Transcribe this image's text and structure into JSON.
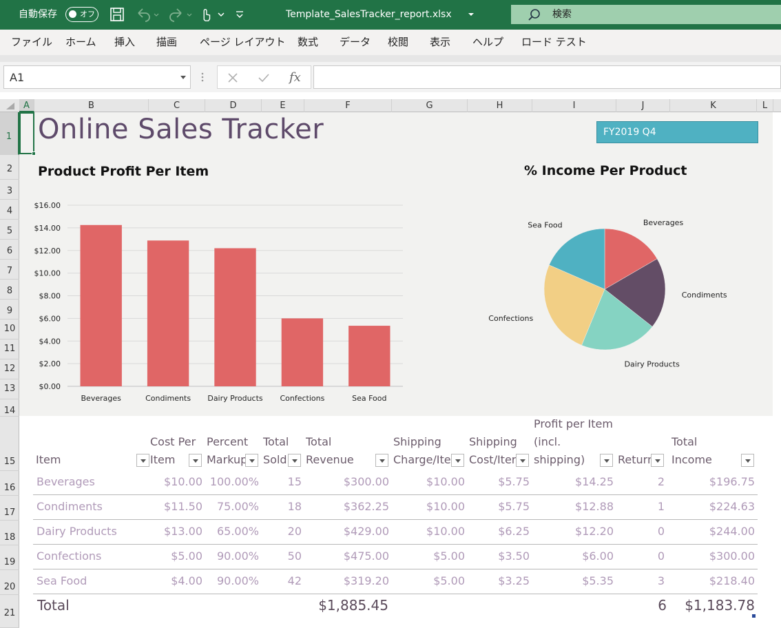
{
  "titlebar": {
    "autosave_label": "自動保存",
    "autosave_state": "オフ",
    "filename": "Template_SalesTracker_report.xlsx",
    "search_placeholder": "検索"
  },
  "menu": [
    "ファイル",
    "ホーム",
    "挿入",
    "描画",
    "ページ レイアウト",
    "数式",
    "データ",
    "校閲",
    "表示",
    "ヘルプ",
    "ロード テスト"
  ],
  "formula_bar": {
    "name_box": "A1",
    "fx": "fx",
    "formula": ""
  },
  "columns": [
    "A",
    "B",
    "C",
    "D",
    "E",
    "F",
    "G",
    "H",
    "I",
    "J",
    "K",
    "L"
  ],
  "rows": [
    "1",
    "2",
    "3",
    "4",
    "5",
    "6",
    "7",
    "8",
    "9",
    "10",
    "11",
    "12",
    "13",
    "14",
    "15",
    "16",
    "17",
    "18",
    "19",
    "20",
    "21"
  ],
  "sheet": {
    "title": "Online Sales Tracker",
    "period": "FY2019 Q4"
  },
  "chart_data": [
    {
      "type": "bar",
      "title": "Product Profit Per Item",
      "categories": [
        "Beverages",
        "Condiments",
        "Dairy Products",
        "Confections",
        "Sea Food"
      ],
      "values": [
        14.25,
        12.88,
        12.2,
        6.0,
        5.35
      ],
      "ylim": [
        0,
        16
      ],
      "yticks": [
        "$0.00",
        "$2.00",
        "$4.00",
        "$6.00",
        "$8.00",
        "$10.00",
        "$12.00",
        "$14.00",
        "$16.00"
      ],
      "grid": true,
      "color": "#e06666"
    },
    {
      "type": "pie",
      "title": "% Income Per Product",
      "categories": [
        "Beverages",
        "Condiments",
        "Dairy Products",
        "Confections",
        "Sea Food"
      ],
      "values": [
        196.75,
        224.63,
        244.0,
        300.0,
        218.4
      ],
      "colors": [
        "#e06666",
        "#634d66",
        "#85d3c2",
        "#f2cf85",
        "#4fb1c2"
      ]
    }
  ],
  "table": {
    "headers": [
      [
        "Item"
      ],
      [
        "Cost Per",
        "Item"
      ],
      [
        "Percent",
        "Markup"
      ],
      [
        "Total",
        "Sold"
      ],
      [
        "Total",
        "Revenue"
      ],
      [
        "Shipping",
        "Charge/Ite"
      ],
      [
        "Shipping",
        "Cost/Iter"
      ],
      [
        "Profit per Item",
        "(incl.",
        "shipping)"
      ],
      [
        "Return"
      ],
      [
        "Total",
        "Income"
      ]
    ],
    "rows": [
      [
        "Beverages",
        "$10.00",
        "100.00%",
        "15",
        "$300.00",
        "$10.00",
        "$5.75",
        "$14.25",
        "2",
        "$196.75"
      ],
      [
        "Condiments",
        "$11.50",
        "75.00%",
        "18",
        "$362.25",
        "$10.00",
        "$5.75",
        "$12.88",
        "1",
        "$224.63"
      ],
      [
        "Dairy Products",
        "$13.00",
        "65.00%",
        "20",
        "$429.00",
        "$10.00",
        "$6.25",
        "$12.20",
        "0",
        "$244.00"
      ],
      [
        "Confections",
        "$5.00",
        "90.00%",
        "50",
        "$475.00",
        "$5.00",
        "$3.50",
        "$6.00",
        "0",
        "$300.00"
      ],
      [
        "Sea Food",
        "$4.00",
        "90.00%",
        "42",
        "$319.20",
        "$5.00",
        "$3.25",
        "$5.35",
        "3",
        "$218.40"
      ]
    ],
    "total": {
      "label": "Total",
      "revenue": "$1,885.45",
      "returns": "6",
      "income": "$1,183.78"
    }
  }
}
